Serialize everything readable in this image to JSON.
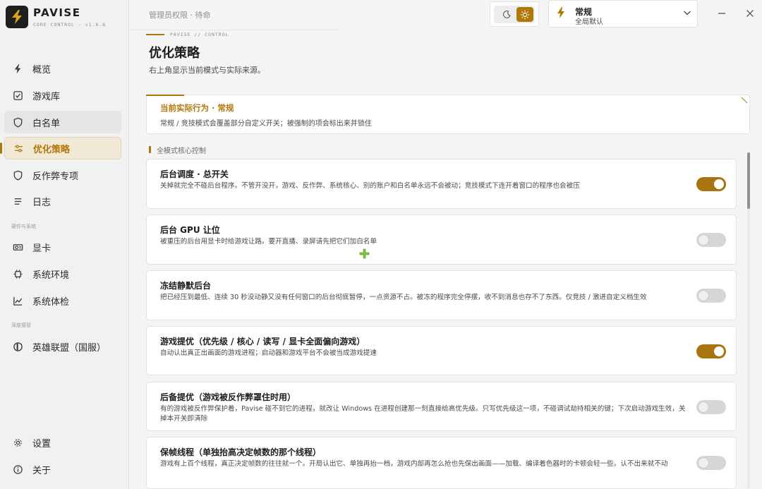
{
  "app": {
    "name": "PAVISE",
    "subtitle": "CORE CONTROL · v1.6.6"
  },
  "topbar": {
    "status_label": "管理员权限 · 待命",
    "mode_title": "常规",
    "mode_subtitle": "全局默认"
  },
  "sidebar": {
    "items": [
      {
        "label": "概览",
        "icon": "bolt-icon"
      },
      {
        "label": "游戏库",
        "icon": "checkbox-icon"
      },
      {
        "label": "白名单",
        "icon": "shield-icon"
      },
      {
        "label": "优化策略",
        "icon": "sliders-icon"
      },
      {
        "label": "反作弊专项",
        "icon": "shield-icon"
      },
      {
        "label": "日志",
        "icon": "list-icon"
      }
    ],
    "section_hardware": "硬件与系统",
    "hardware_items": [
      {
        "label": "显卡",
        "icon": "gpu-icon"
      },
      {
        "label": "系统环境",
        "icon": "chip-icon"
      },
      {
        "label": "系统体检",
        "icon": "chart-icon"
      }
    ],
    "section_deep": "深度接管",
    "deep_items": [
      {
        "label": "英雄联盟（国服）",
        "icon": "lol-icon"
      }
    ],
    "bottom_items": [
      {
        "label": "设置",
        "icon": "gear-icon"
      },
      {
        "label": "关于",
        "icon": "info-icon"
      }
    ]
  },
  "header": {
    "crumb": "PAVISE  //  CONTROL",
    "title": "优化策略",
    "description": "右上角显示当前模式与实际来源。"
  },
  "notice": {
    "title": "当前实际行为 · 常规",
    "text": "常规 / 竞技模式会覆盖部分自定义开关；被强制的项会标出来并锁住"
  },
  "section": {
    "title": "全模式核心控制"
  },
  "cards": [
    {
      "title": "后台调度 · 总开关",
      "desc": "关掉就完全不碰后台程序。不管开没开，游戏、反作弊、系统核心、别的账户和白名单永远不会被动；竞技模式下连开着窗口的程序也会被压",
      "on": true
    },
    {
      "title": "后台 GPU 让位",
      "desc": "被重压的后台用显卡时给游戏让路。要开直播、录屏请先把它们加白名单",
      "on": false
    },
    {
      "title": "冻结静默后台",
      "desc": "把已经压到最低、连续 30 秒没动静又没有任何窗口的后台彻底暂停，一点资源不占。被冻的程序完全停摆，收不到消息也存不了东西。仅竞技 / 激进自定义档生效",
      "on": false
    },
    {
      "title": "游戏提优（优先级 / 核心 / 读写 / 显卡全面偏向游戏）",
      "desc": "自动认出真正出画面的游戏进程；启动器和游戏平台不会被当成游戏提速",
      "on": true
    },
    {
      "title": "后备提优（游戏被反作弊罩住时用）",
      "desc": "有的游戏被反作弊保护着，Pavise 碰不到它的进程，就改让 Windows 在进程创建那一刻直接给高优先级。只写优先级这一项，不碰调试劫持相关的键；下次启动游戏生效，关掉本开关即清除",
      "on": false
    },
    {
      "title": "保帧线程（单独抬高决定帧数的那个线程）",
      "desc": "游戏有上百个线程，真正决定帧数的往往就一个。开局认出它、单独再抬一档，游戏内部再怎么抢也先保出画面——加载、编译着色器时的卡顿会轻一些。认不出来就不动",
      "on": false
    }
  ],
  "colors": {
    "accent": "#b0780a",
    "toggle_on": "#a87410",
    "toggle_off": "#d6d6d6"
  }
}
